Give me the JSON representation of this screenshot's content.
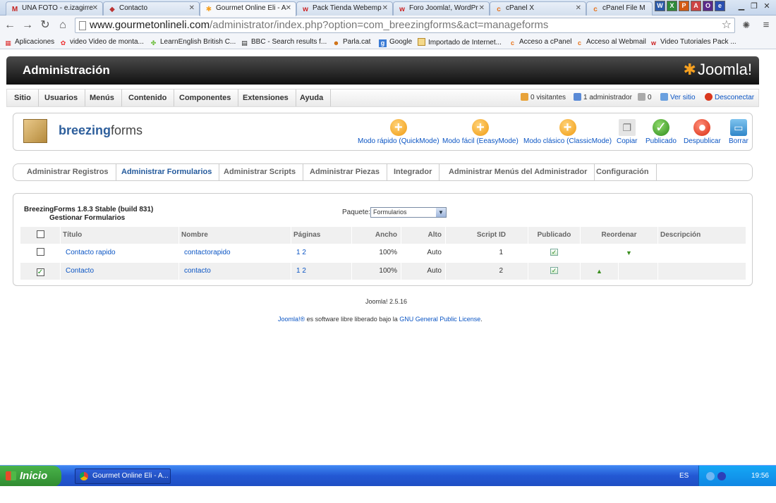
{
  "browser": {
    "tabs": [
      {
        "label": "UNA FOTO - e.izagirre",
        "icon": "gmail-icon"
      },
      {
        "label": "Contacto",
        "icon": "site-icon"
      },
      {
        "label": "Gourmet Online Eli - A",
        "icon": "joomla-icon"
      },
      {
        "label": "Pack Tienda Webemp",
        "icon": "webempresa-icon"
      },
      {
        "label": "Foro Joomla!, WordPr",
        "icon": "webempresa-icon"
      },
      {
        "label": "cPanel X",
        "icon": "cpanel-icon"
      },
      {
        "label": "cPanel File M",
        "icon": "cpanel-icon"
      }
    ],
    "address": {
      "domain": "www.gourmetonlineli.com",
      "path": "/administrator/index.php?option=com_breezingforms&act=manageforms"
    },
    "bookmarks": [
      {
        "label": "Aplicaciones"
      },
      {
        "label": "video Video de monta..."
      },
      {
        "label": "LearnEnglish British C..."
      },
      {
        "label": "BBC - Search results f..."
      },
      {
        "label": "Parla.cat"
      },
      {
        "label": "Google"
      },
      {
        "label": "Importado de Internet..."
      },
      {
        "label": "Acceso a cPanel"
      },
      {
        "label": "Acceso al Webmail"
      },
      {
        "label": "Video Tutoriales Pack ..."
      }
    ]
  },
  "admin": {
    "title": "Administración",
    "logo": "Joomla!",
    "menu": [
      "Sitio",
      "Usuarios",
      "Menús",
      "Contenido",
      "Componentes",
      "Extensiones",
      "Ayuda"
    ],
    "status": {
      "visitors": "0 visitantes",
      "admins": "1 administrador",
      "messages": "0",
      "view_site": "Ver sitio",
      "logout": "Desconectar"
    }
  },
  "component": {
    "brand_bold": "breezing",
    "brand_light": "forms",
    "toolbar": [
      {
        "label": "Modo rápido (QuickMode)",
        "icon": "plus-icon"
      },
      {
        "label": "Modo fácil (EeasyMode)",
        "icon": "plus-icon"
      },
      {
        "label": "Modo clásico (ClassicMode)",
        "icon": "plus-icon"
      },
      {
        "label": "Copiar",
        "icon": "copy-icon"
      },
      {
        "label": "Publicado",
        "icon": "check-icon"
      },
      {
        "label": "Despublicar",
        "icon": "unpublish-icon"
      },
      {
        "label": "Borrar",
        "icon": "trash-icon"
      }
    ],
    "subnav": [
      "Administrar Registros",
      "Administrar Formularios",
      "Administrar Scripts",
      "Administrar Piezas",
      "Integrador",
      "Administrar Menús del Administrador",
      "Configuración"
    ],
    "active_subnav": "Administrar Formularios"
  },
  "panel": {
    "version": "BreezingForms 1.8.3 Stable (build 831)",
    "subtitle": "Gestionar Formularios",
    "package_label": "Paquete:",
    "package_value": "Formularios",
    "columns": [
      "Título",
      "Nombre",
      "Páginas",
      "Ancho",
      "Alto",
      "Script ID",
      "Publicado",
      "Reordenar",
      "Descripción"
    ],
    "rows": [
      {
        "checked": false,
        "title": "Contacto rapido",
        "name": "contactorapido",
        "pages": "1 2",
        "width": "100%",
        "height": "Auto",
        "script_id": "1",
        "published": true,
        "reorder": "down"
      },
      {
        "checked": true,
        "title": "Contacto",
        "name": "contacto",
        "pages": "1 2",
        "width": "100%",
        "height": "Auto",
        "script_id": "2",
        "published": true,
        "reorder": "up"
      }
    ]
  },
  "footer": {
    "version": "Joomla! 2.5.16",
    "license_pre": "Joomla!®",
    "license_mid": " es software libre liberado bajo la ",
    "license_link": "GNU General Public License",
    "license_post": "."
  },
  "taskbar": {
    "start": "Inicio",
    "task": "Gourmet Online Eli - A...",
    "lang": "ES",
    "clock": "19:56"
  }
}
